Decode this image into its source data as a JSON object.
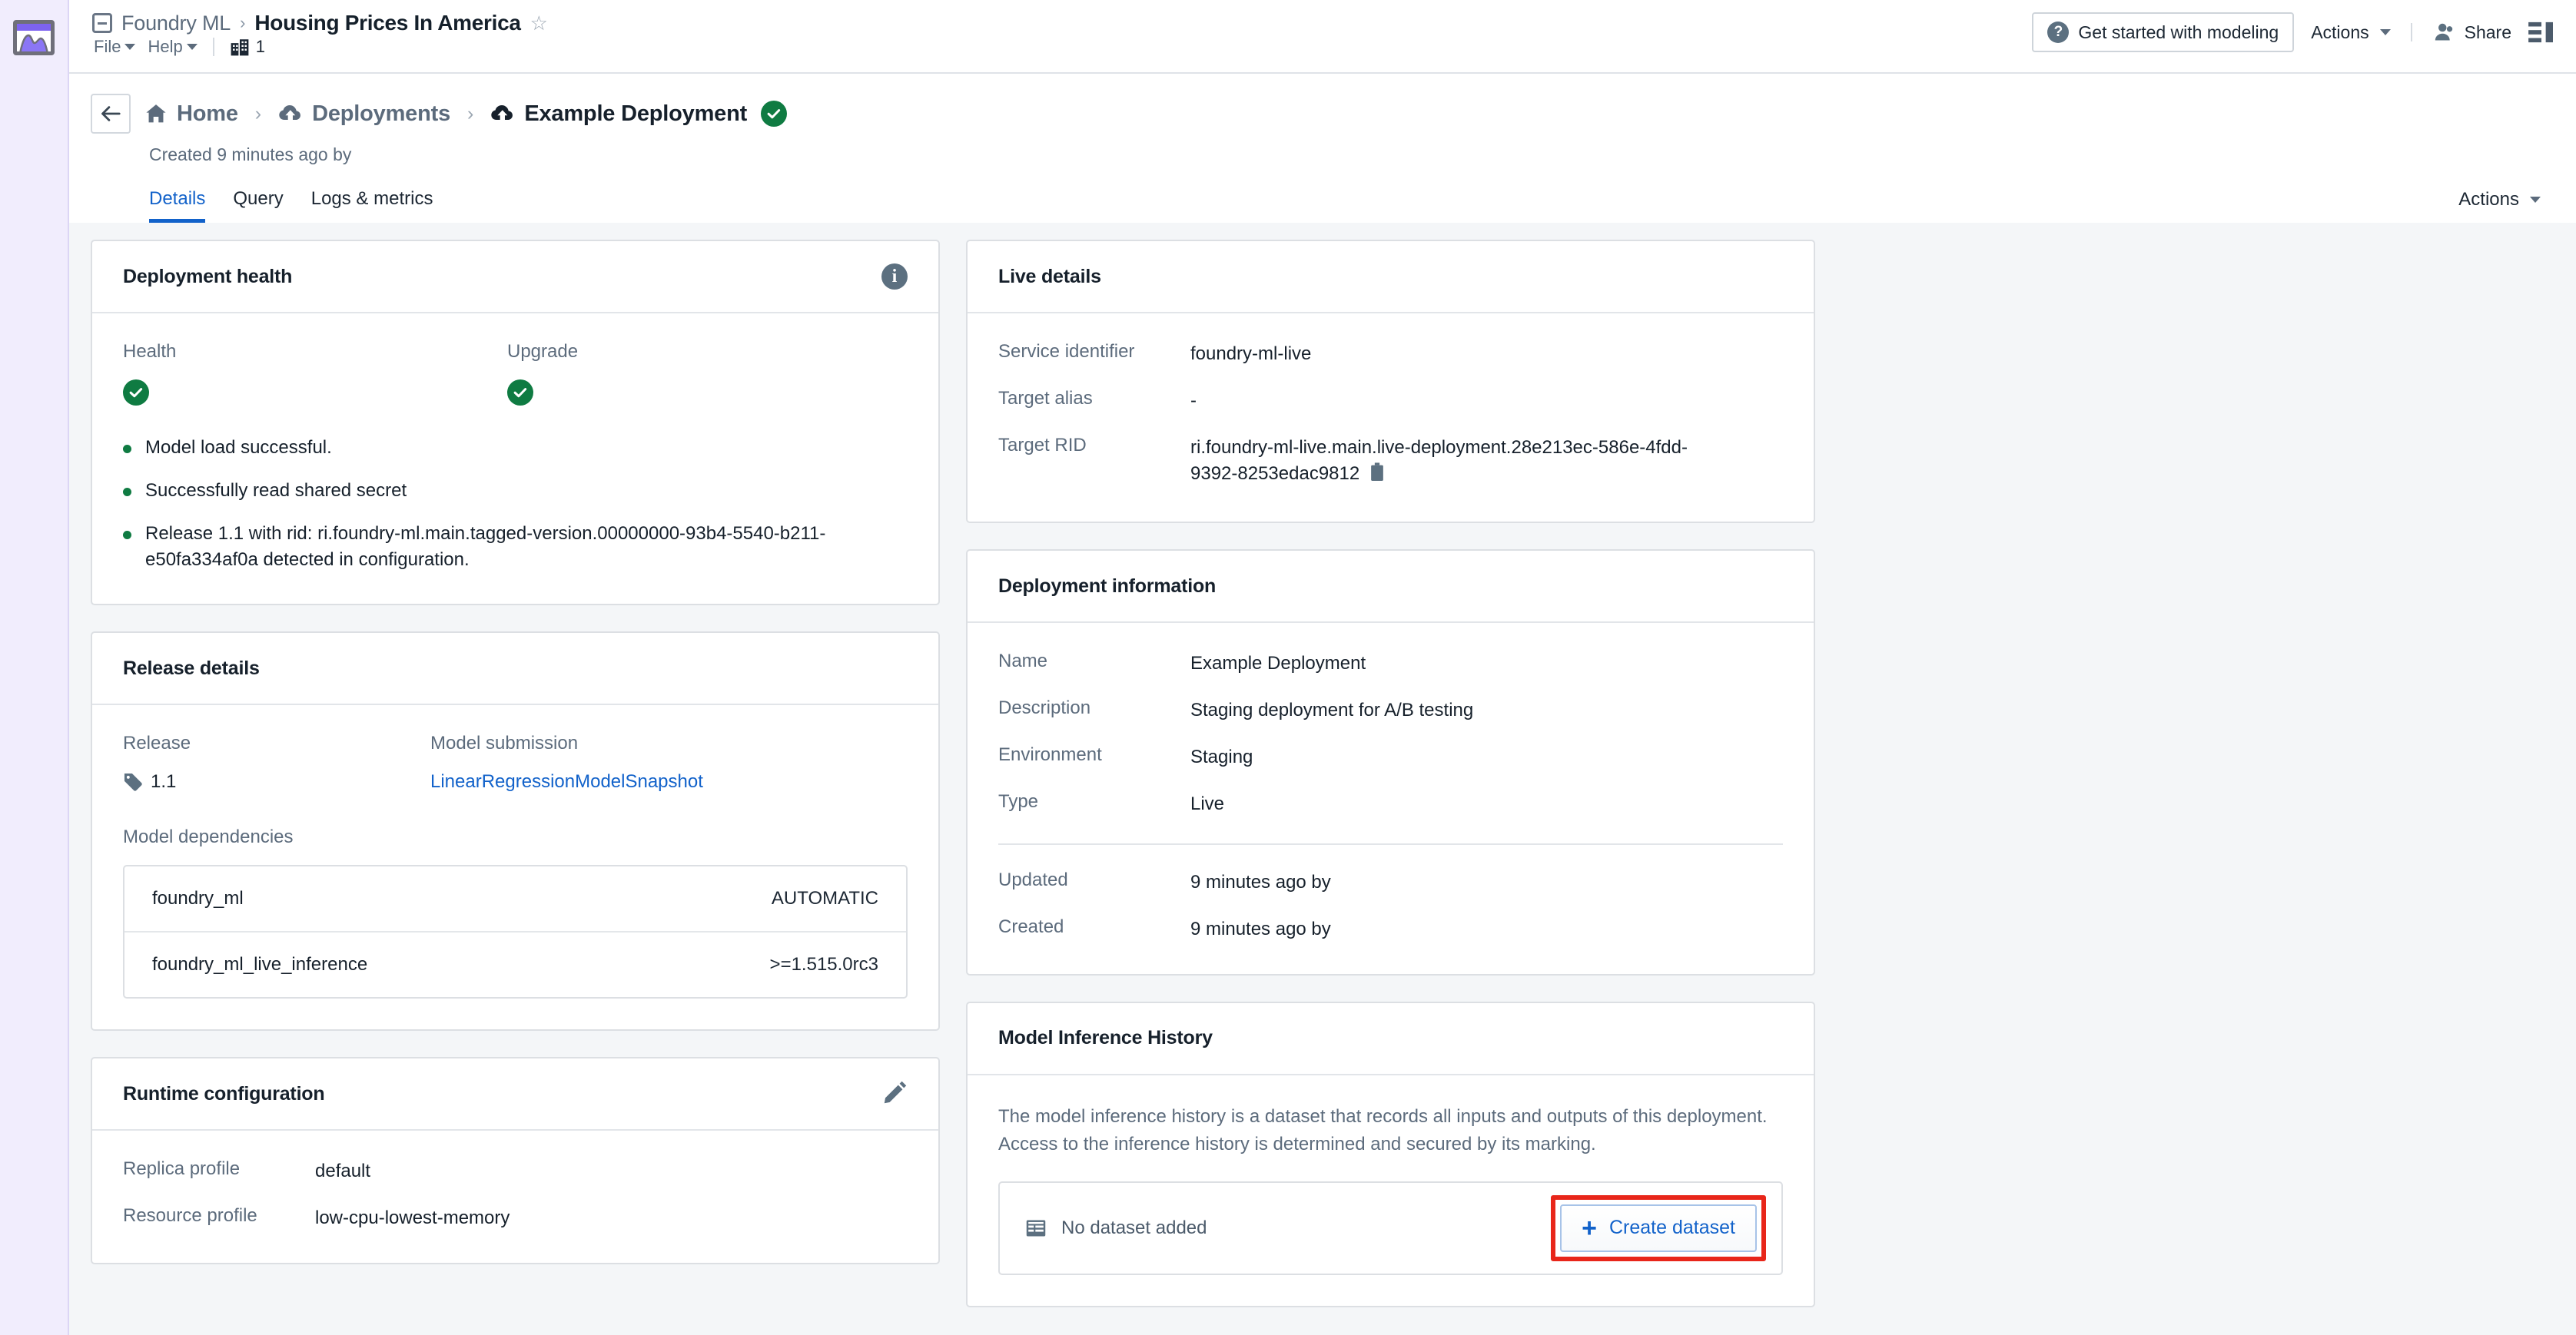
{
  "topbar": {
    "workspace": "Foundry ML",
    "breadcrumb_separator": "›",
    "document_title": "Housing Prices In America",
    "star_icon": "star-outline-icon",
    "doc_icon": "document-icon",
    "menus": [
      {
        "label": "File"
      },
      {
        "label": "Help"
      }
    ],
    "org_count": "1",
    "org_icon": "building-icon",
    "get_started_label": "Get started with modeling",
    "help_icon": "question-circle-icon",
    "actions_label": "Actions",
    "share_label": "Share",
    "share_icon": "user-icon",
    "panel_icon": "panel-toggle-icon"
  },
  "header": {
    "back_icon": "arrow-left-icon",
    "breadcrumbs": [
      {
        "label": "Home",
        "icon": "home-icon"
      },
      {
        "label": "Deployments",
        "icon": "cloud-upload-icon"
      },
      {
        "label": "Example Deployment",
        "icon": "cloud-upload-icon"
      }
    ],
    "separator": "›",
    "status_icon": "check-circle-icon",
    "created_text": "Created 9 minutes ago by",
    "actions_label": "Actions",
    "tabs": [
      {
        "label": "Details",
        "active": true
      },
      {
        "label": "Query",
        "active": false
      },
      {
        "label": "Logs & metrics",
        "active": false
      }
    ]
  },
  "deployment_health": {
    "title": "Deployment health",
    "info_icon": "info-circle-icon",
    "health_label": "Health",
    "health_status_icon": "check-circle-icon",
    "upgrade_label": "Upgrade",
    "upgrade_status_icon": "check-circle-icon",
    "bullets": [
      "Model load successful.",
      "Successfully read shared secret",
      "Release 1.1 with rid: ri.foundry-ml.main.tagged-version.00000000-93b4-5540-b211-e50fa334af0a detected in configuration."
    ]
  },
  "release_details": {
    "title": "Release details",
    "release_label": "Release",
    "release_value": "1.1",
    "release_tag_icon": "tag-icon",
    "model_submission_label": "Model submission",
    "model_submission_value": "LinearRegressionModelSnapshot",
    "dependencies_label": "Model dependencies",
    "dependencies": [
      {
        "name": "foundry_ml",
        "version": "AUTOMATIC"
      },
      {
        "name": "foundry_ml_live_inference",
        "version": ">=1.515.0rc3"
      }
    ]
  },
  "runtime_configuration": {
    "title": "Runtime configuration",
    "edit_icon": "pencil-icon",
    "rows": [
      {
        "key": "Replica profile",
        "value": "default"
      },
      {
        "key": "Resource profile",
        "value": "low-cpu-lowest-memory"
      }
    ]
  },
  "live_details": {
    "title": "Live details",
    "rows": [
      {
        "key": "Service identifier",
        "value": "foundry-ml-live"
      },
      {
        "key": "Target alias",
        "value": "-"
      },
      {
        "key": "Target RID",
        "value": "ri.foundry-ml-live.main.live-deployment.28e213ec-586e-4fdd-9392-8253edac9812"
      }
    ],
    "copy_icon": "clipboard-icon"
  },
  "deployment_information": {
    "title": "Deployment information",
    "rows_primary": [
      {
        "key": "Name",
        "value": "Example Deployment"
      },
      {
        "key": "Description",
        "value": "Staging deployment for A/B testing"
      },
      {
        "key": "Environment",
        "value": "Staging"
      },
      {
        "key": "Type",
        "value": "Live"
      }
    ],
    "rows_secondary": [
      {
        "key": "Updated",
        "value": "9 minutes ago by"
      },
      {
        "key": "Created",
        "value": "9 minutes ago by"
      }
    ]
  },
  "model_inference_history": {
    "title": "Model Inference History",
    "description": "The model inference history is a dataset that records all inputs and outputs of this deployment. Access to the inference history is determined and secured by its marking.",
    "empty_label": "No dataset added",
    "empty_icon": "table-icon",
    "create_button_label": "Create dataset",
    "create_button_icon": "plus-icon",
    "highlight_color": "#e8261a"
  },
  "colors": {
    "accent_blue": "#1262ca",
    "success_green": "#0f7b42",
    "muted_text": "#5c6b7c",
    "page_bg": "#f4f6f8",
    "rail_bg": "#f1edfd"
  }
}
